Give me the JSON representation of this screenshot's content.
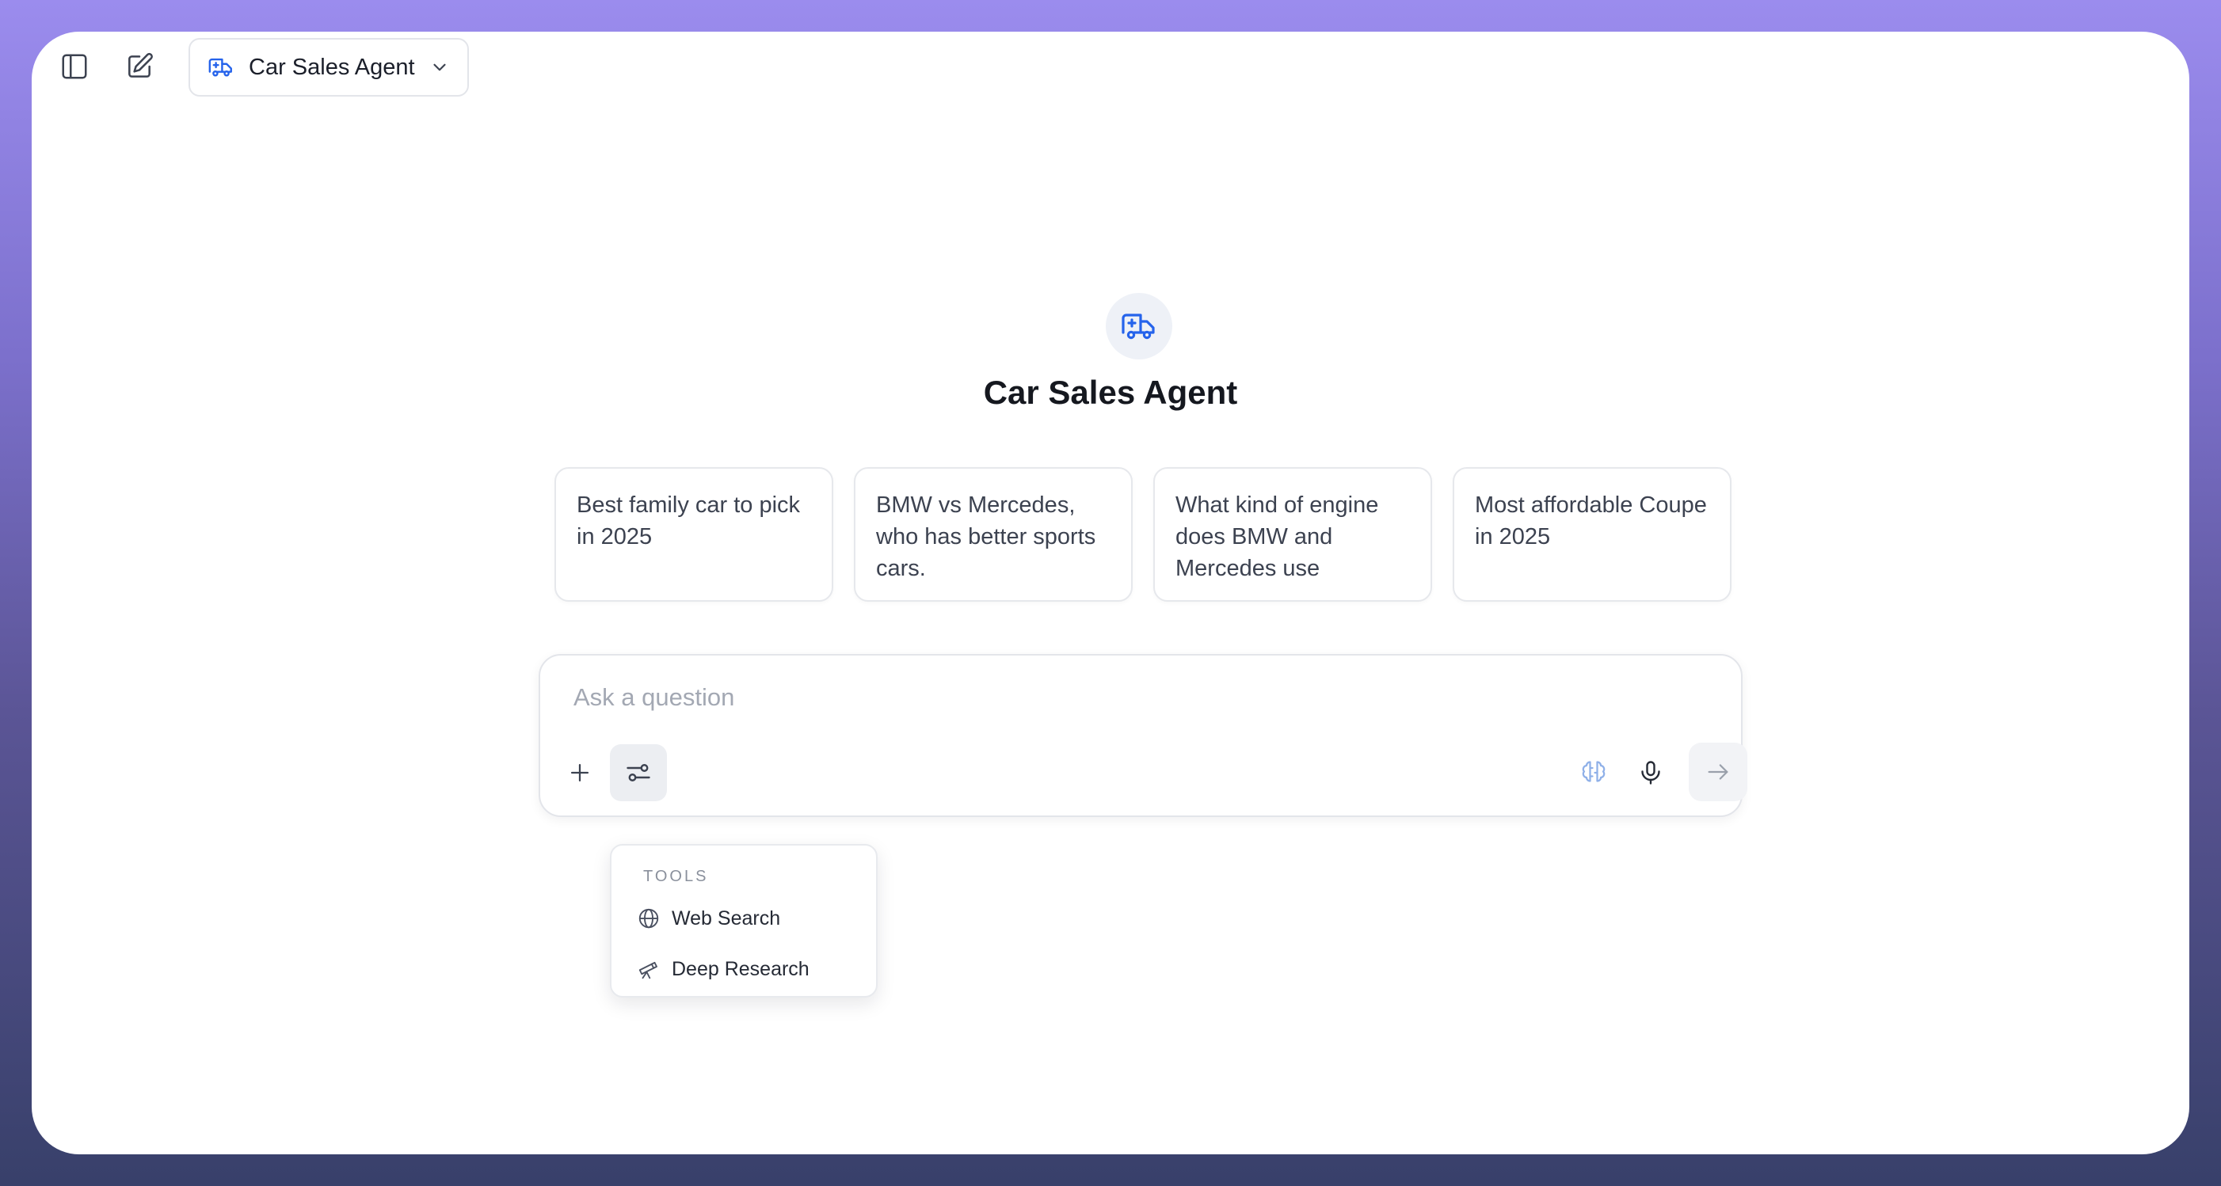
{
  "header": {
    "agent_name": "Car Sales Agent",
    "sidebar_toggle_icon": "sidebar-panel-icon",
    "new_chat_icon": "edit-pencil-icon",
    "agent_icon": "ambulance-icon",
    "dropdown_icon": "chevron-down-icon"
  },
  "hero": {
    "title": "Car Sales Agent",
    "icon": "ambulance-icon",
    "accent_color": "#2563eb"
  },
  "suggestions": [
    {
      "text": "Best family car to pick in 2025"
    },
    {
      "text": "BMW vs Mercedes, who has better sports cars."
    },
    {
      "text": "What kind of engine does BMW and Mercedes use"
    },
    {
      "text": "Most affordable Coupe in 2025"
    }
  ],
  "composer": {
    "placeholder": "Ask a question",
    "value": "",
    "icons": {
      "attach": "plus-icon",
      "tools": "sliders-icon",
      "model": "brain-icon",
      "voice": "microphone-icon",
      "send": "arrow-right-icon"
    }
  },
  "tools_menu": {
    "heading": "TOOLS",
    "items": [
      {
        "label": "Web Search",
        "icon": "globe-icon"
      },
      {
        "label": "Deep Research",
        "icon": "telescope-icon"
      }
    ]
  }
}
